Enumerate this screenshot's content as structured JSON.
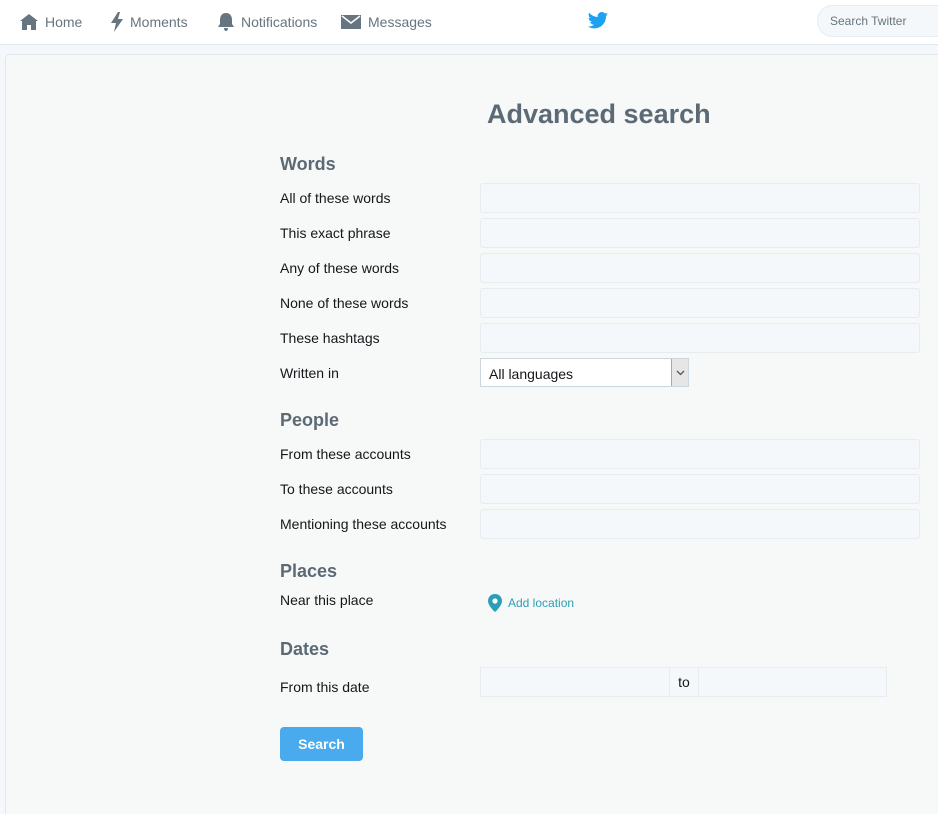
{
  "nav": {
    "home_label": "Home",
    "moments_label": "Moments",
    "notifications_label": "Notifications",
    "messages_label": "Messages",
    "search_placeholder": "Search Twitter"
  },
  "colors": {
    "brand": "#1da1f2",
    "button": "#4aaaee",
    "heading": "#5b6a75"
  },
  "form": {
    "title": "Advanced search",
    "words": {
      "title": "Words",
      "all_words_label": "All of these words",
      "exact_phrase_label": "This exact phrase",
      "any_words_label": "Any of these words",
      "none_words_label": "None of these words",
      "hashtags_label": "These hashtags",
      "written_in_label": "Written in",
      "language_value": "All languages"
    },
    "people": {
      "title": "People",
      "from_label": "From these accounts",
      "to_label": "To these accounts",
      "mentioning_label": "Mentioning these accounts"
    },
    "places": {
      "title": "Places",
      "near_label": "Near this place",
      "add_location_label": "Add location"
    },
    "dates": {
      "title": "Dates",
      "from_date_label": "From this date",
      "to_label": "to"
    },
    "search_button_label": "Search"
  }
}
